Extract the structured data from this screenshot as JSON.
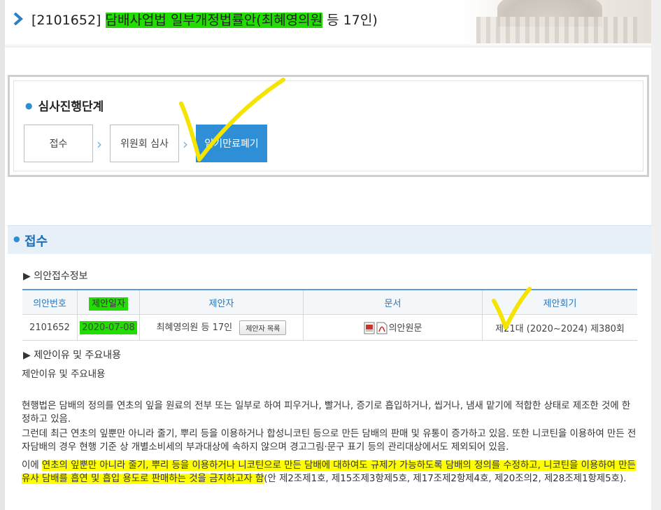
{
  "header": {
    "bill_number": "[2101652]",
    "bill_title_highlighted": "담배사업법 일부개정법률안(최혜영의원",
    "bill_title_rest": " 등 17인)"
  },
  "stages": {
    "title": "심사진행단계",
    "items": [
      {
        "label": "접수"
      },
      {
        "label": "위원회 심사"
      },
      {
        "label": "임기만료폐기"
      }
    ]
  },
  "section": {
    "title": "접수"
  },
  "receipt_info": {
    "heading": "▶ 의안접수정보",
    "columns": [
      "의안번호",
      "제안일자",
      "제안자",
      "문서",
      "제안회기"
    ],
    "row": {
      "bill_no": "2101652",
      "date": "2020-07-08",
      "proposer": "최혜영의원 등 17인",
      "proposer_button": "제안자 목록",
      "document": "의안원문",
      "session": "제21대 (2020~2024) 제380회"
    }
  },
  "reason": {
    "heading": "▶ 제안이유 및 주요내용",
    "subtitle": "제안이유 및 주요내용",
    "para1": "현행법은 담배의 정의를 연초의 잎을 원료의 전부 또는 일부로 하여 피우거나, 빨거나, 증기로 흡입하거나, 씹거나, 냄새 맡기에 적합한 상태로 제조한 것에 한정하고 있음.",
    "para2": "그런데 최근 연초의 잎뿐만 아니라 줄기, 뿌리 등을 이용하거나 합성니코틴 등으로 만든 담배의 판매 및 유통이 증가하고 있음. 또한 니코틴을 이용하여 만든 전자담배의 경우 현행 기준 상 개별소비세의 부과대상에 속하지 않으며 경고그림·문구 표기 등의 관리대상에서도 제외되어 있음.",
    "para3_prefix": "이에 ",
    "para3_highlight": "연초의 잎뿐만 아니라 줄기, 뿌리 등을 이용하거나 니코틴으로 만든 담배에 대하여도 규제가 가능하도록 담배의 정의를 수정하고, 니코틴을 이용하여 만든 유사 담배를 흡연 및 흡입 용도로 판매하는 것을 금지하고자 함",
    "para3_suffix": "(안 제2조제1호, 제15조제3항제5호, 제17조제2항제4호, 제20조의2, 제28조제1항제5호)."
  },
  "colors": {
    "accent": "#2e8fd6",
    "highlight_green": "#22dd00",
    "highlight_yellow": "#ffff00",
    "annotation_check": "#f5e400"
  }
}
